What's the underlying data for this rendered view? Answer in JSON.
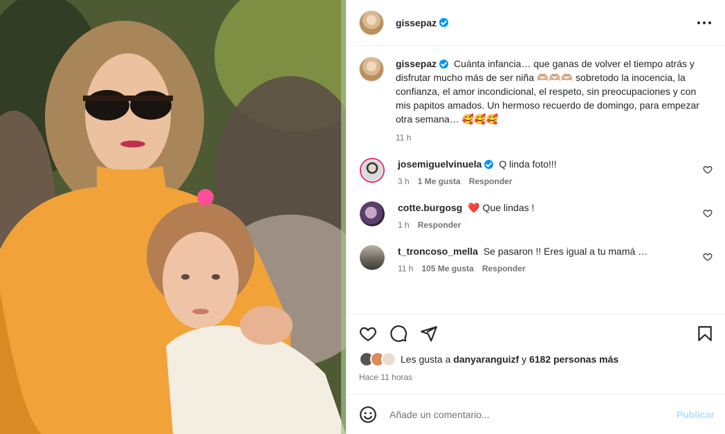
{
  "post": {
    "owner": "gissepaz",
    "caption": "Cuánta infancia… que ganas de volver el tiempo atrás y disfrutar mucho más de ser niña 🫶🏼🫶🏼🫶🏼 sobretodo la inocencia, la confianza, el amor incondicional, el respeto, sin preocupaciones y con mis papitos amados. Un hermoso recuerdo de domingo, para empezar otra semana… 🥰🥰🥰",
    "caption_time": "11 h"
  },
  "icons": {
    "more": "more-options-icon",
    "verified": "verified-badge-icon",
    "like": "heart-icon",
    "comment": "comment-icon",
    "share": "share-icon",
    "save": "bookmark-icon",
    "emoji": "emoji-icon"
  },
  "comments": [
    {
      "user": "josemiguelvinuela",
      "verified": true,
      "text": "Q linda foto!!!",
      "time": "3 h",
      "likes": "1 Me gusta",
      "reply": "Responder"
    },
    {
      "user": "cotte.burgosg",
      "verified": false,
      "text": "❤️ Que lindas !",
      "time": "1 h",
      "likes": "",
      "reply": "Responder"
    },
    {
      "user": "t_troncoso_mella",
      "verified": false,
      "text": "Se pasaron !! Eres igual a tu mamá …",
      "time": "11 h",
      "likes": "105 Me gusta",
      "reply": "Responder"
    }
  ],
  "likes": {
    "prefix": "Les gusta a",
    "user": "danyaranguizf",
    "connector": "y",
    "others": "6182 personas más"
  },
  "posted": "Hace 11 horas",
  "add_comment": {
    "placeholder": "Añade un comentario...",
    "publish": "Publicar"
  },
  "colors": {
    "accent": "#0095f6",
    "publish_disabled": "#b2dffc",
    "heart": "#ed4956"
  }
}
